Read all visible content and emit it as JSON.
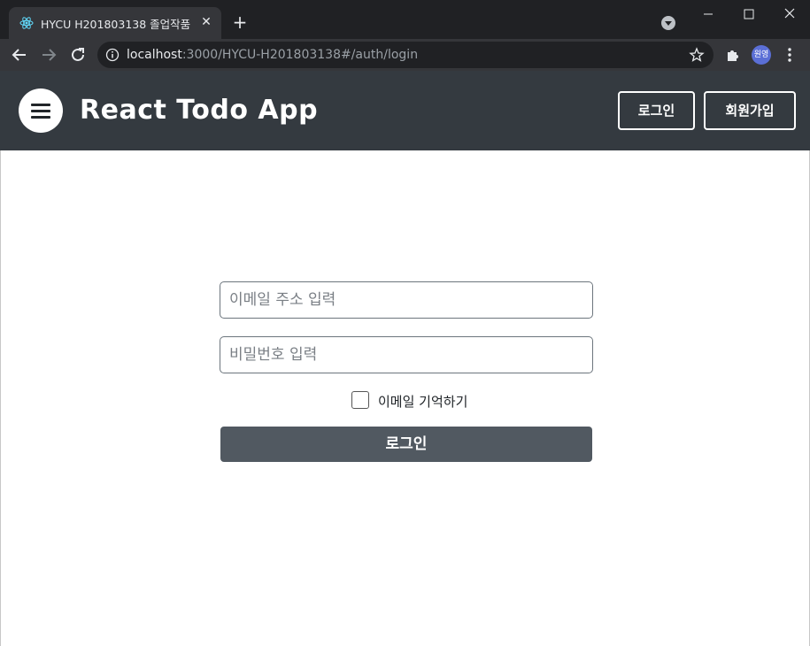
{
  "browser": {
    "tab_title": "HYCU H201803138 졸업작품",
    "url_host": "localhost",
    "url_rest": ":3000/HYCU-H201803138#/auth/login",
    "profile_initials": "원영"
  },
  "header": {
    "brand": "React Todo App",
    "login_label": "로그인",
    "signup_label": "회원가입"
  },
  "form": {
    "email_placeholder": "이메일 주소 입력",
    "email_value": "",
    "password_placeholder": "비밀번호 입력",
    "password_value": "",
    "remember_label": "이메일 기억하기",
    "remember_checked": false,
    "submit_label": "로그인"
  },
  "colors": {
    "header_bg": "#343a40",
    "submit_bg": "#515961",
    "browser_frame": "#202124"
  }
}
